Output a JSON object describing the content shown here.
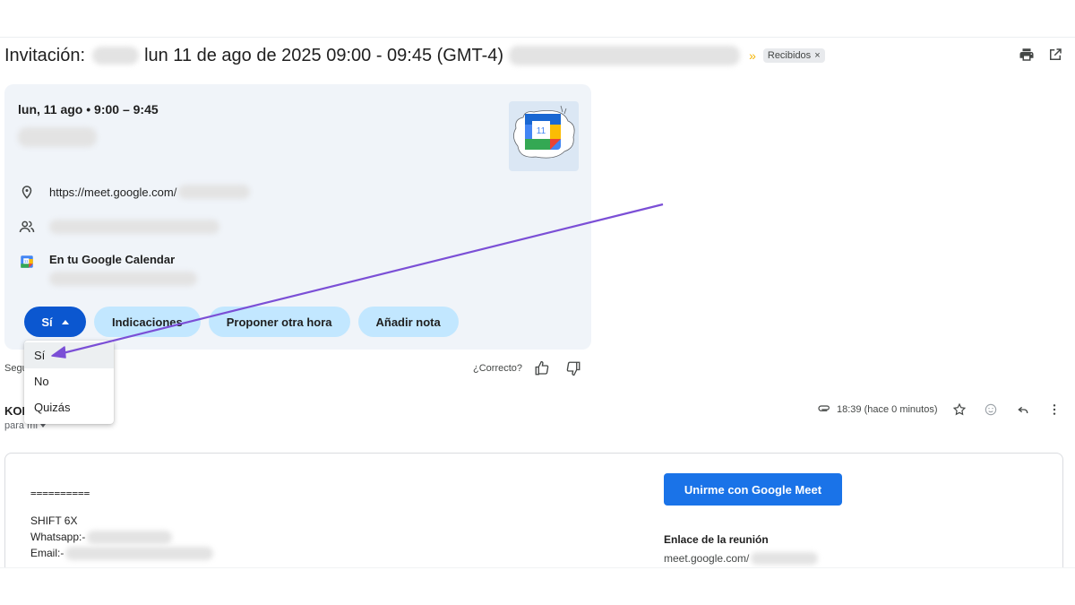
{
  "subject": {
    "prefix": "Invitación:",
    "datetime": "lun 11 de ago de 2025 09:00 - 09:45 (GMT-4)",
    "label": "Recibidos",
    "label_close": "×",
    "importance_marker": "»"
  },
  "header_icons": [
    "print-icon",
    "open-in-new-window-icon"
  ],
  "invite": {
    "when": "lun, 11 ago • 9:00 – 9:45",
    "calendar_day": "11",
    "location_link": "https://meet.google.com/",
    "calendar_label": "En tu Google Calendar",
    "rsvp": {
      "current": "Sí",
      "options": [
        "Sí",
        "No",
        "Quizás"
      ],
      "selected_index": 0
    },
    "actions": [
      "Indicaciones",
      "Proponer otra hora",
      "Añadir nota"
    ]
  },
  "feedback": {
    "partial_text": "Segu",
    "question": "¿Correcto?"
  },
  "message": {
    "sender_partial": "KOF",
    "recipient": "para mí",
    "time": "18:39 (hace 0 minutos)",
    "body_lines": [
      "==========",
      "SHIFT 6X",
      "Whatsapp:-",
      "Email:-"
    ],
    "join_button": "Unirme con Google Meet",
    "link_heading": "Enlace de la reunión",
    "link_value": "meet.google.com/"
  },
  "colors": {
    "primary_button": "#0b57d0",
    "secondary_button": "#c2e7ff",
    "card_bg": "#f0f4f9",
    "join_button": "#1a73e8",
    "annotation_arrow": "#7b4fd6"
  }
}
